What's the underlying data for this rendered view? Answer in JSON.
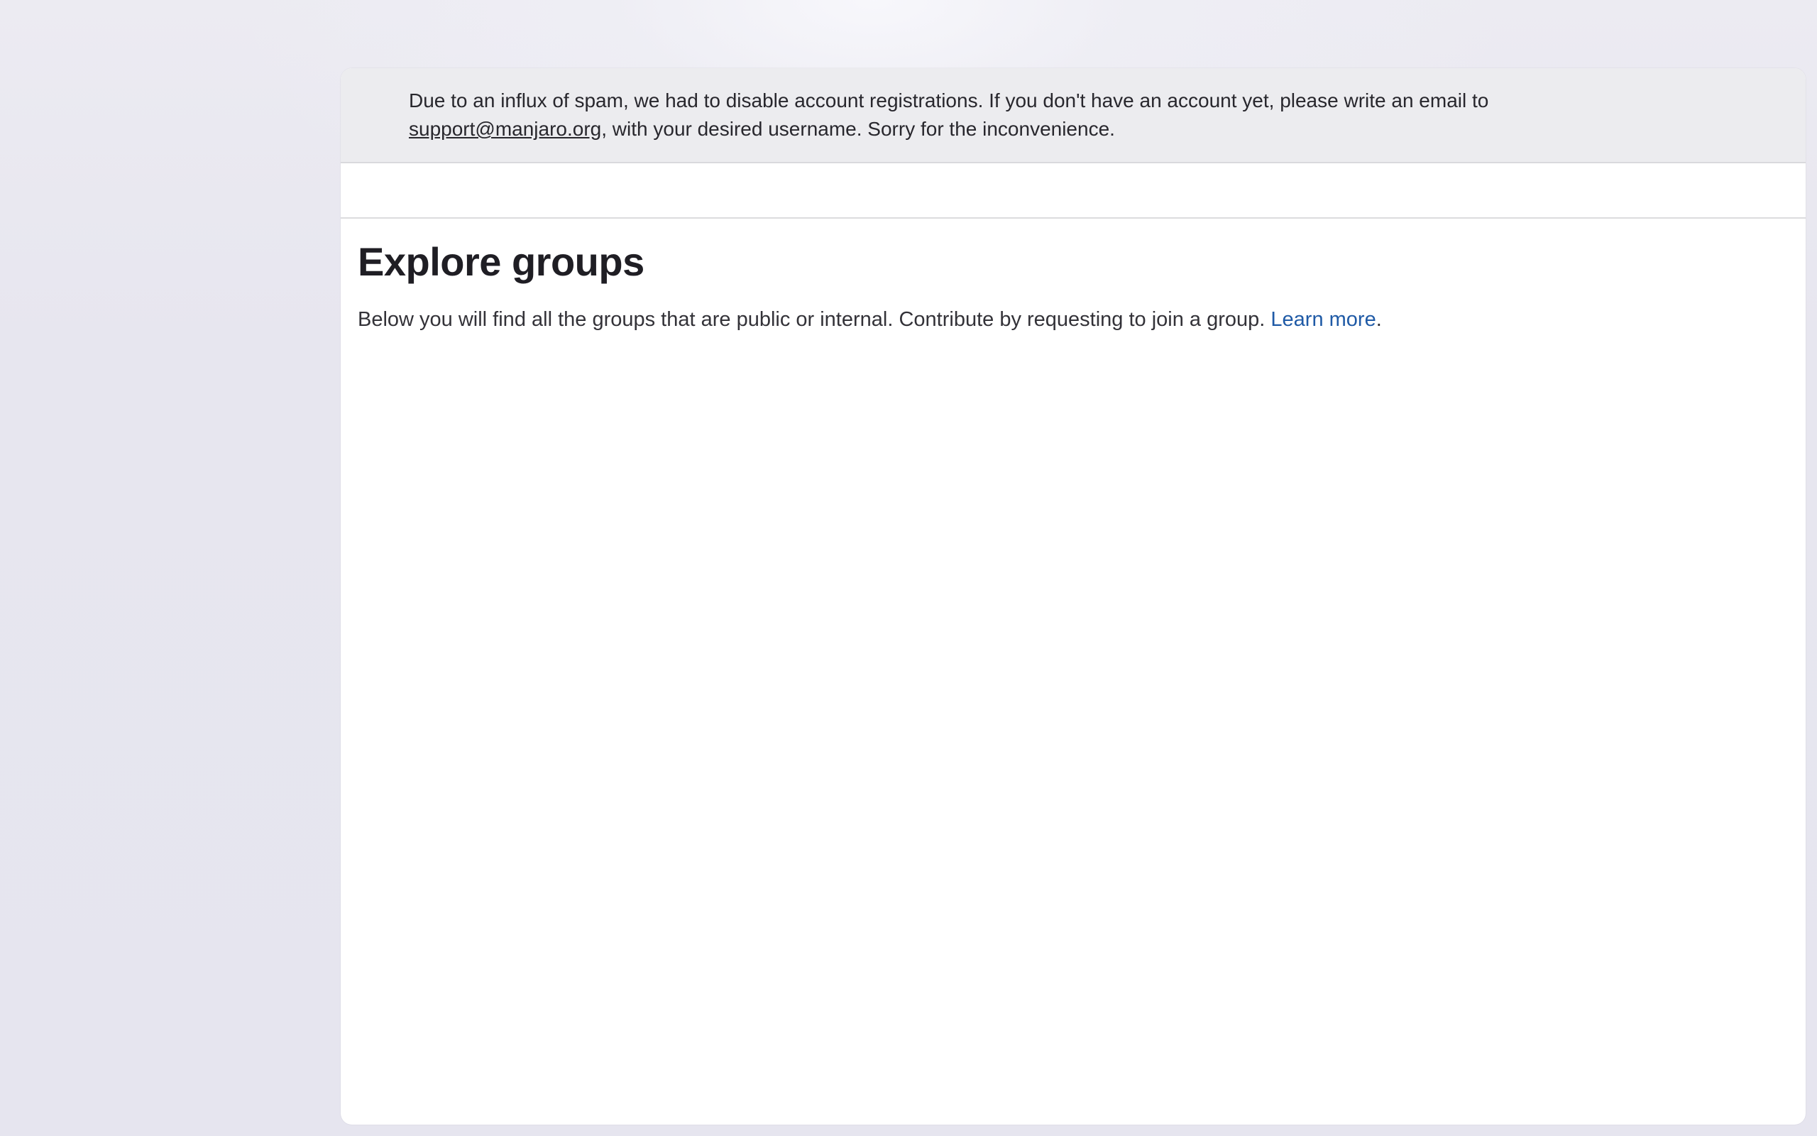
{
  "banner": {
    "text_before": "Due to an influx of spam, we had to disable account registrations. If you don't have an account yet, please write an email to",
    "email_link": "support@manjaro.org",
    "text_after": ", with your desired username. Sorry for the inconvenience."
  },
  "page": {
    "title": "Explore groups",
    "description": "Below you will find all the groups that are public or internal. Contribute by requesting to join a group.",
    "learn_more_label": "Learn more",
    "description_end": "."
  },
  "colors": {
    "link": "#1f5aa6",
    "banner_bg": "#ececef",
    "page_bg": "#e8e6f0"
  }
}
